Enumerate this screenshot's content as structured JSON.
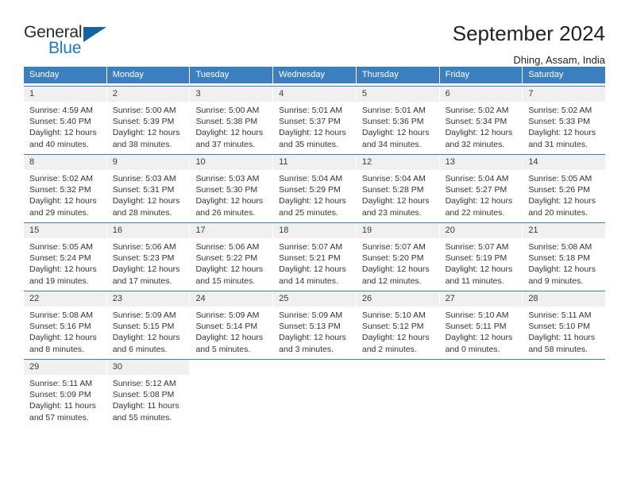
{
  "brand": {
    "name_part1": "General",
    "name_part2": "Blue",
    "logo_icon": "triangle-logo-icon"
  },
  "header": {
    "title": "September 2024",
    "location": "Dhing, Assam, India"
  },
  "calendar": {
    "weekday_headers": [
      "Sunday",
      "Monday",
      "Tuesday",
      "Wednesday",
      "Thursday",
      "Friday",
      "Saturday"
    ],
    "colors": {
      "header_blue": "#3c7fc1",
      "day_number_background": "#f0f0f0",
      "brand_blue": "#1a79c8",
      "text": "#333333"
    },
    "weeks": [
      [
        {
          "day": "1",
          "sunrise": "Sunrise: 4:59 AM",
          "sunset": "Sunset: 5:40 PM",
          "daylight_line1": "Daylight: 12 hours",
          "daylight_line2": "and 40 minutes."
        },
        {
          "day": "2",
          "sunrise": "Sunrise: 5:00 AM",
          "sunset": "Sunset: 5:39 PM",
          "daylight_line1": "Daylight: 12 hours",
          "daylight_line2": "and 38 minutes."
        },
        {
          "day": "3",
          "sunrise": "Sunrise: 5:00 AM",
          "sunset": "Sunset: 5:38 PM",
          "daylight_line1": "Daylight: 12 hours",
          "daylight_line2": "and 37 minutes."
        },
        {
          "day": "4",
          "sunrise": "Sunrise: 5:01 AM",
          "sunset": "Sunset: 5:37 PM",
          "daylight_line1": "Daylight: 12 hours",
          "daylight_line2": "and 35 minutes."
        },
        {
          "day": "5",
          "sunrise": "Sunrise: 5:01 AM",
          "sunset": "Sunset: 5:36 PM",
          "daylight_line1": "Daylight: 12 hours",
          "daylight_line2": "and 34 minutes."
        },
        {
          "day": "6",
          "sunrise": "Sunrise: 5:02 AM",
          "sunset": "Sunset: 5:34 PM",
          "daylight_line1": "Daylight: 12 hours",
          "daylight_line2": "and 32 minutes."
        },
        {
          "day": "7",
          "sunrise": "Sunrise: 5:02 AM",
          "sunset": "Sunset: 5:33 PM",
          "daylight_line1": "Daylight: 12 hours",
          "daylight_line2": "and 31 minutes."
        }
      ],
      [
        {
          "day": "8",
          "sunrise": "Sunrise: 5:02 AM",
          "sunset": "Sunset: 5:32 PM",
          "daylight_line1": "Daylight: 12 hours",
          "daylight_line2": "and 29 minutes."
        },
        {
          "day": "9",
          "sunrise": "Sunrise: 5:03 AM",
          "sunset": "Sunset: 5:31 PM",
          "daylight_line1": "Daylight: 12 hours",
          "daylight_line2": "and 28 minutes."
        },
        {
          "day": "10",
          "sunrise": "Sunrise: 5:03 AM",
          "sunset": "Sunset: 5:30 PM",
          "daylight_line1": "Daylight: 12 hours",
          "daylight_line2": "and 26 minutes."
        },
        {
          "day": "11",
          "sunrise": "Sunrise: 5:04 AM",
          "sunset": "Sunset: 5:29 PM",
          "daylight_line1": "Daylight: 12 hours",
          "daylight_line2": "and 25 minutes."
        },
        {
          "day": "12",
          "sunrise": "Sunrise: 5:04 AM",
          "sunset": "Sunset: 5:28 PM",
          "daylight_line1": "Daylight: 12 hours",
          "daylight_line2": "and 23 minutes."
        },
        {
          "day": "13",
          "sunrise": "Sunrise: 5:04 AM",
          "sunset": "Sunset: 5:27 PM",
          "daylight_line1": "Daylight: 12 hours",
          "daylight_line2": "and 22 minutes."
        },
        {
          "day": "14",
          "sunrise": "Sunrise: 5:05 AM",
          "sunset": "Sunset: 5:26 PM",
          "daylight_line1": "Daylight: 12 hours",
          "daylight_line2": "and 20 minutes."
        }
      ],
      [
        {
          "day": "15",
          "sunrise": "Sunrise: 5:05 AM",
          "sunset": "Sunset: 5:24 PM",
          "daylight_line1": "Daylight: 12 hours",
          "daylight_line2": "and 19 minutes."
        },
        {
          "day": "16",
          "sunrise": "Sunrise: 5:06 AM",
          "sunset": "Sunset: 5:23 PM",
          "daylight_line1": "Daylight: 12 hours",
          "daylight_line2": "and 17 minutes."
        },
        {
          "day": "17",
          "sunrise": "Sunrise: 5:06 AM",
          "sunset": "Sunset: 5:22 PM",
          "daylight_line1": "Daylight: 12 hours",
          "daylight_line2": "and 15 minutes."
        },
        {
          "day": "18",
          "sunrise": "Sunrise: 5:07 AM",
          "sunset": "Sunset: 5:21 PM",
          "daylight_line1": "Daylight: 12 hours",
          "daylight_line2": "and 14 minutes."
        },
        {
          "day": "19",
          "sunrise": "Sunrise: 5:07 AM",
          "sunset": "Sunset: 5:20 PM",
          "daylight_line1": "Daylight: 12 hours",
          "daylight_line2": "and 12 minutes."
        },
        {
          "day": "20",
          "sunrise": "Sunrise: 5:07 AM",
          "sunset": "Sunset: 5:19 PM",
          "daylight_line1": "Daylight: 12 hours",
          "daylight_line2": "and 11 minutes."
        },
        {
          "day": "21",
          "sunrise": "Sunrise: 5:08 AM",
          "sunset": "Sunset: 5:18 PM",
          "daylight_line1": "Daylight: 12 hours",
          "daylight_line2": "and 9 minutes."
        }
      ],
      [
        {
          "day": "22",
          "sunrise": "Sunrise: 5:08 AM",
          "sunset": "Sunset: 5:16 PM",
          "daylight_line1": "Daylight: 12 hours",
          "daylight_line2": "and 8 minutes."
        },
        {
          "day": "23",
          "sunrise": "Sunrise: 5:09 AM",
          "sunset": "Sunset: 5:15 PM",
          "daylight_line1": "Daylight: 12 hours",
          "daylight_line2": "and 6 minutes."
        },
        {
          "day": "24",
          "sunrise": "Sunrise: 5:09 AM",
          "sunset": "Sunset: 5:14 PM",
          "daylight_line1": "Daylight: 12 hours",
          "daylight_line2": "and 5 minutes."
        },
        {
          "day": "25",
          "sunrise": "Sunrise: 5:09 AM",
          "sunset": "Sunset: 5:13 PM",
          "daylight_line1": "Daylight: 12 hours",
          "daylight_line2": "and 3 minutes."
        },
        {
          "day": "26",
          "sunrise": "Sunrise: 5:10 AM",
          "sunset": "Sunset: 5:12 PM",
          "daylight_line1": "Daylight: 12 hours",
          "daylight_line2": "and 2 minutes."
        },
        {
          "day": "27",
          "sunrise": "Sunrise: 5:10 AM",
          "sunset": "Sunset: 5:11 PM",
          "daylight_line1": "Daylight: 12 hours",
          "daylight_line2": "and 0 minutes."
        },
        {
          "day": "28",
          "sunrise": "Sunrise: 5:11 AM",
          "sunset": "Sunset: 5:10 PM",
          "daylight_line1": "Daylight: 11 hours",
          "daylight_line2": "and 58 minutes."
        }
      ],
      [
        {
          "day": "29",
          "sunrise": "Sunrise: 5:11 AM",
          "sunset": "Sunset: 5:09 PM",
          "daylight_line1": "Daylight: 11 hours",
          "daylight_line2": "and 57 minutes."
        },
        {
          "day": "30",
          "sunrise": "Sunrise: 5:12 AM",
          "sunset": "Sunset: 5:08 PM",
          "daylight_line1": "Daylight: 11 hours",
          "daylight_line2": "and 55 minutes."
        },
        {
          "day": "",
          "sunrise": "",
          "sunset": "",
          "daylight_line1": "",
          "daylight_line2": ""
        },
        {
          "day": "",
          "sunrise": "",
          "sunset": "",
          "daylight_line1": "",
          "daylight_line2": ""
        },
        {
          "day": "",
          "sunrise": "",
          "sunset": "",
          "daylight_line1": "",
          "daylight_line2": ""
        },
        {
          "day": "",
          "sunrise": "",
          "sunset": "",
          "daylight_line1": "",
          "daylight_line2": ""
        },
        {
          "day": "",
          "sunrise": "",
          "sunset": "",
          "daylight_line1": "",
          "daylight_line2": ""
        }
      ]
    ]
  }
}
